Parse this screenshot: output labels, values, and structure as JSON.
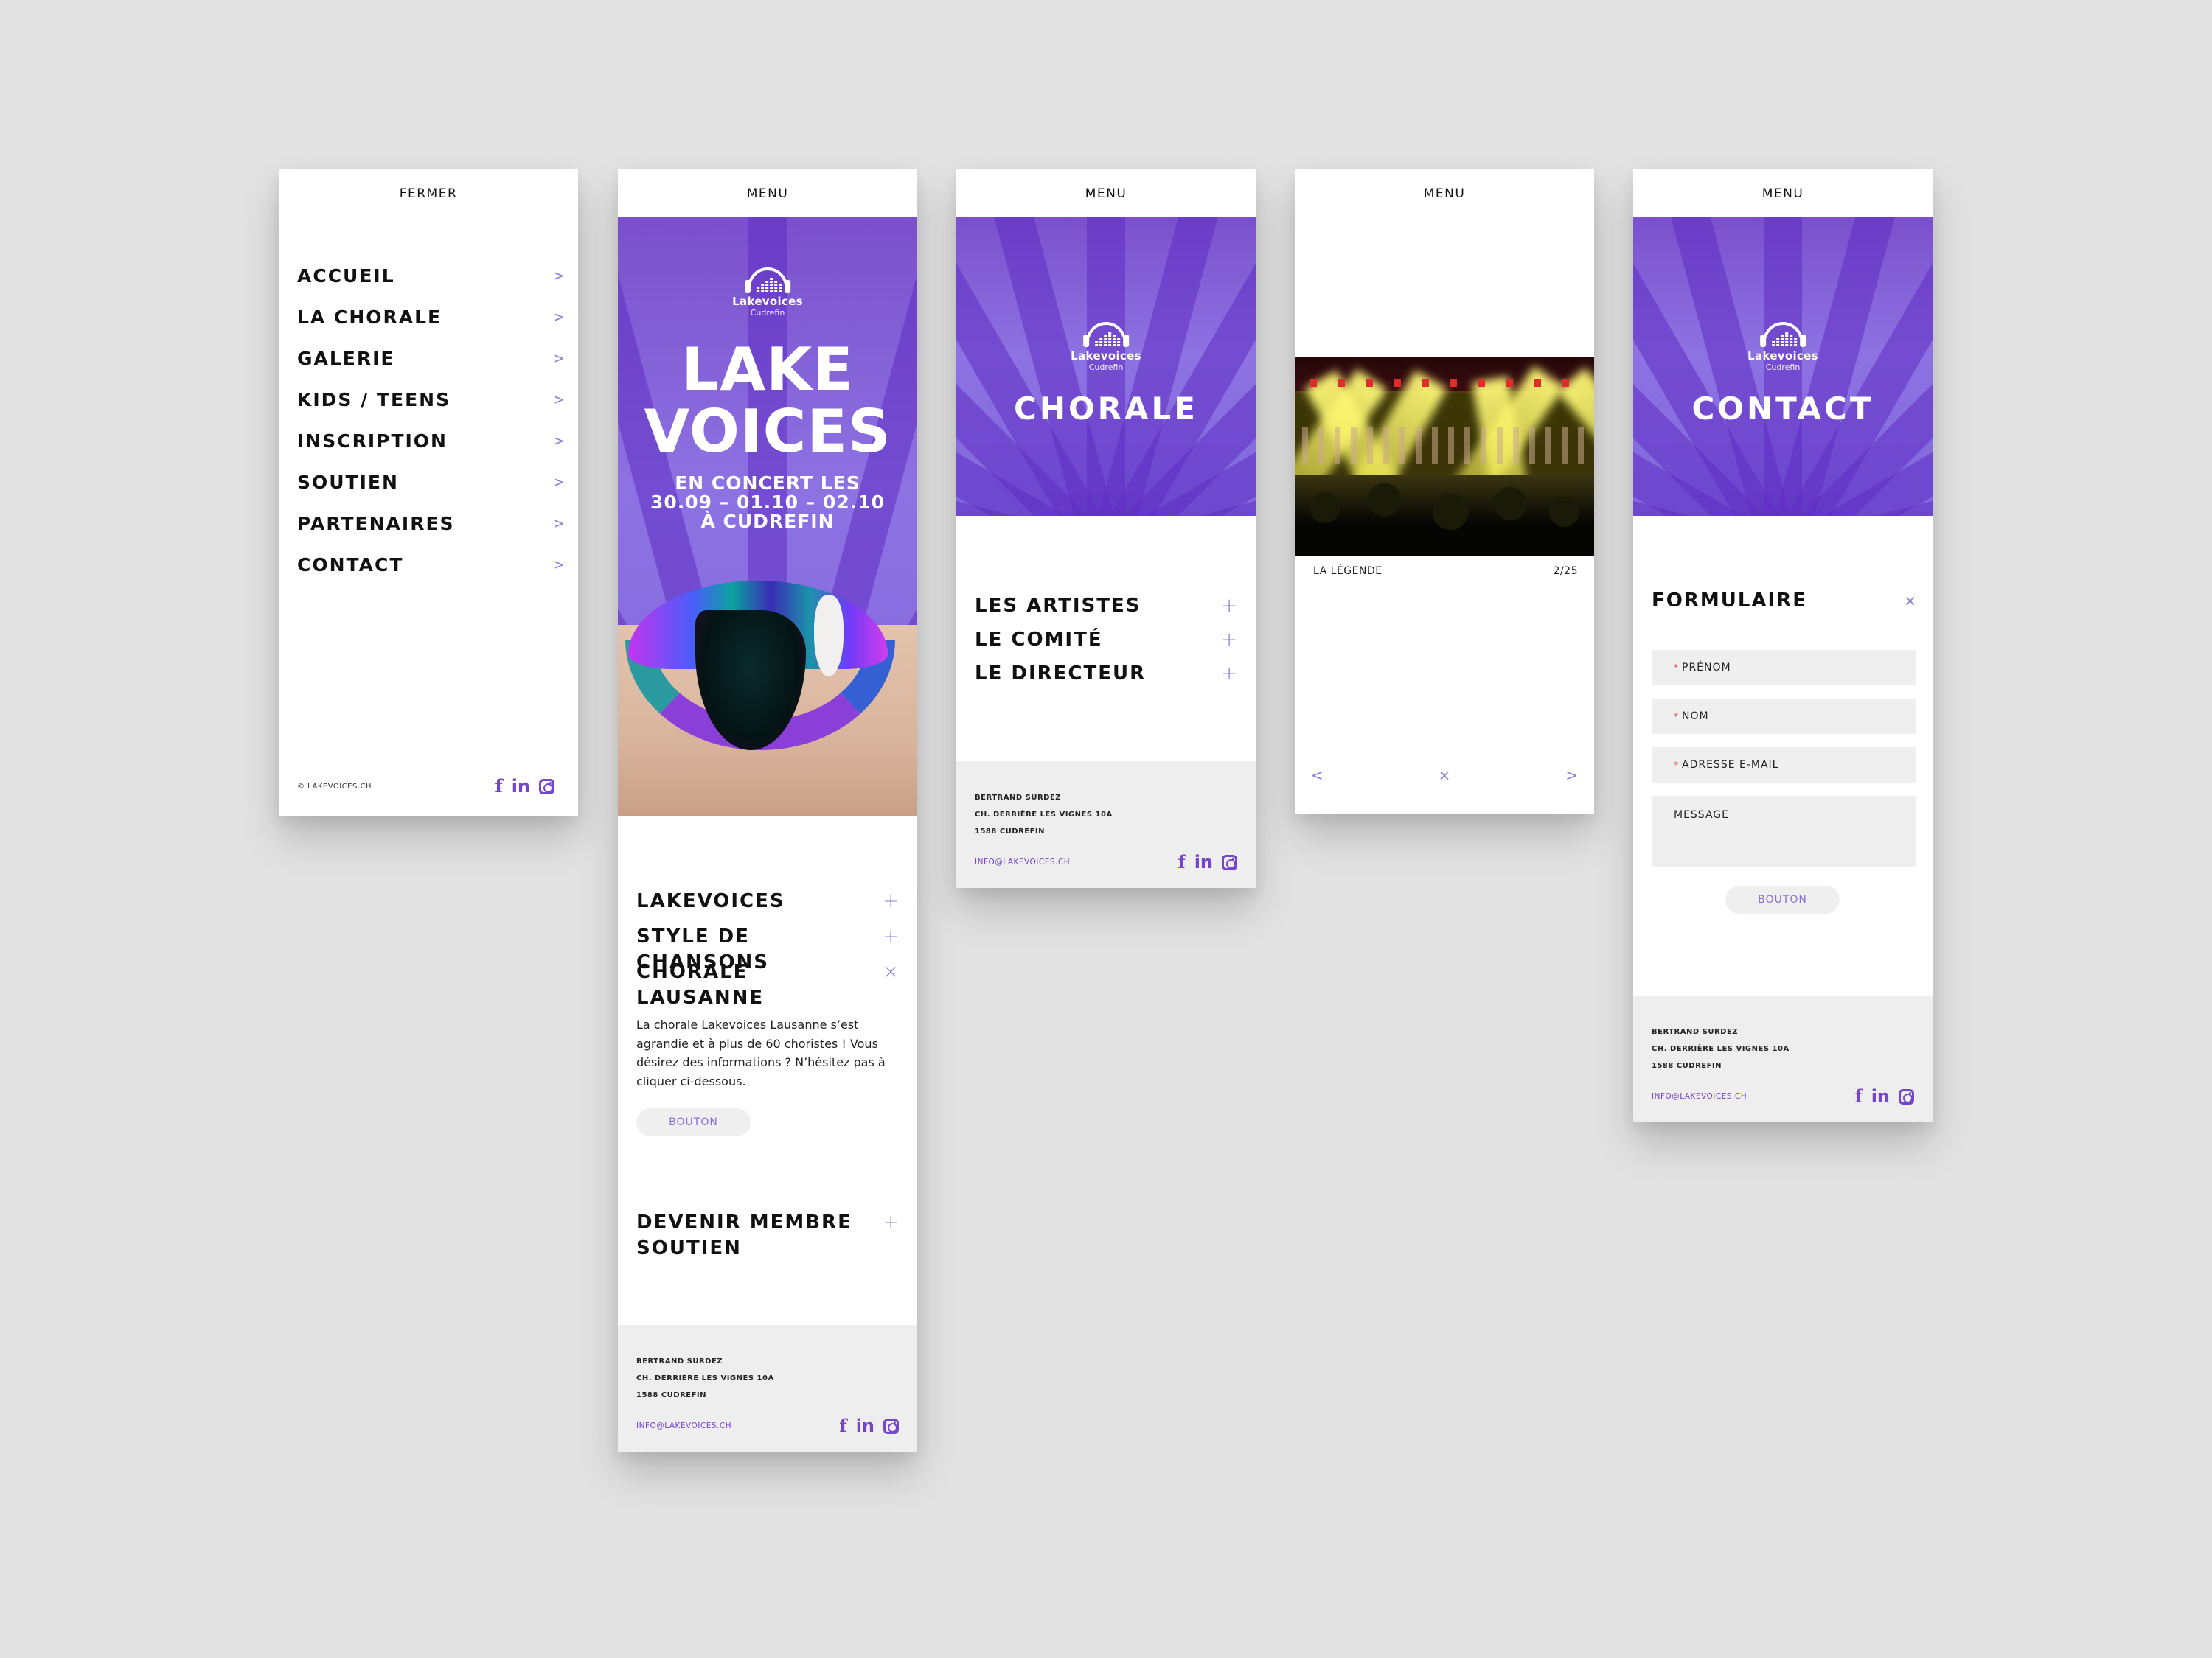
{
  "brand": {
    "name": "Lakevoices",
    "sub": "Cudrefin",
    "accent": "#7446cc",
    "icon_color": "#8a7fd6"
  },
  "menu_screen": {
    "close_label": "FERMER",
    "items": [
      {
        "label": "ACCUEIL",
        "icon": "chevron-right-icon"
      },
      {
        "label": "LA CHORALE",
        "icon": "chevron-right-icon"
      },
      {
        "label": "GALERIE",
        "icon": "chevron-right-icon"
      },
      {
        "label": "KIDS / TEENS",
        "icon": "chevron-right-icon"
      },
      {
        "label": "INSCRIPTION",
        "icon": "chevron-right-icon"
      },
      {
        "label": "SOUTIEN",
        "icon": "chevron-right-icon"
      },
      {
        "label": "PARTENAIRES",
        "icon": "chevron-right-icon"
      },
      {
        "label": "CONTACT",
        "icon": "chevron-right-icon"
      }
    ],
    "chevron": ">",
    "copyright": "© LAKEVOICES.CH"
  },
  "home_screen": {
    "menu_label": "MENU",
    "hero_title_line1": "LAKE",
    "hero_title_line2": "VOICES",
    "hero_sub_line1": "EN CONCERT LES",
    "hero_sub_line2": "30.09 – 01.10 – 02.10",
    "hero_sub_line3": "À CUDREFIN",
    "accordion": [
      {
        "label": "LAKEVOICES",
        "icon": "+"
      },
      {
        "label": "STYLE DE CHANSONS",
        "icon": "+"
      },
      {
        "label": "CHORALE LAUSANNE",
        "icon": "×"
      }
    ],
    "body_text": "La chorale Lakevoices Lausanne s’est agrandie et à plus de 60 choristes ! Vous désirez des informations ? N’hésitez pas à cliquer ci-dessous.",
    "button_label": "BOUTON",
    "second_accordion": {
      "label_line1": "DEVENIR MEMBRE",
      "label_line2": "SOUTIEN",
      "icon": "+"
    }
  },
  "chorale_screen": {
    "menu_label": "MENU",
    "hero_title": "CHORALE",
    "accordion": [
      {
        "label": "LES ARTISTES",
        "icon": "+"
      },
      {
        "label": "LE COMITÉ",
        "icon": "+"
      },
      {
        "label": "LE DIRECTEUR",
        "icon": "+"
      }
    ]
  },
  "gallery_screen": {
    "menu_label": "MENU",
    "caption": "LA LÉGENDE",
    "counter": "2/25",
    "prev": "<",
    "close": "×",
    "next": ">"
  },
  "contact_screen": {
    "menu_label": "MENU",
    "hero_title": "CONTACT",
    "form_title": "FORMULAIRE",
    "form_close": "×",
    "required_mark": "*",
    "fields": {
      "first_name": "PRÉNOM",
      "last_name": "NOM",
      "email": "ADRESSE E-MAIL",
      "message": "MESSAGE"
    },
    "button_label": "BOUTON"
  },
  "footer": {
    "name": "BERTRAND SURDEZ",
    "street": "CH. DERRIÈRE LES VIGNES 10A",
    "city": "1588 CUDREFIN",
    "email": "INFO@LAKEVOICES.CH",
    "social": {
      "facebook": "f",
      "linkedin": "in",
      "instagram": ""
    }
  }
}
